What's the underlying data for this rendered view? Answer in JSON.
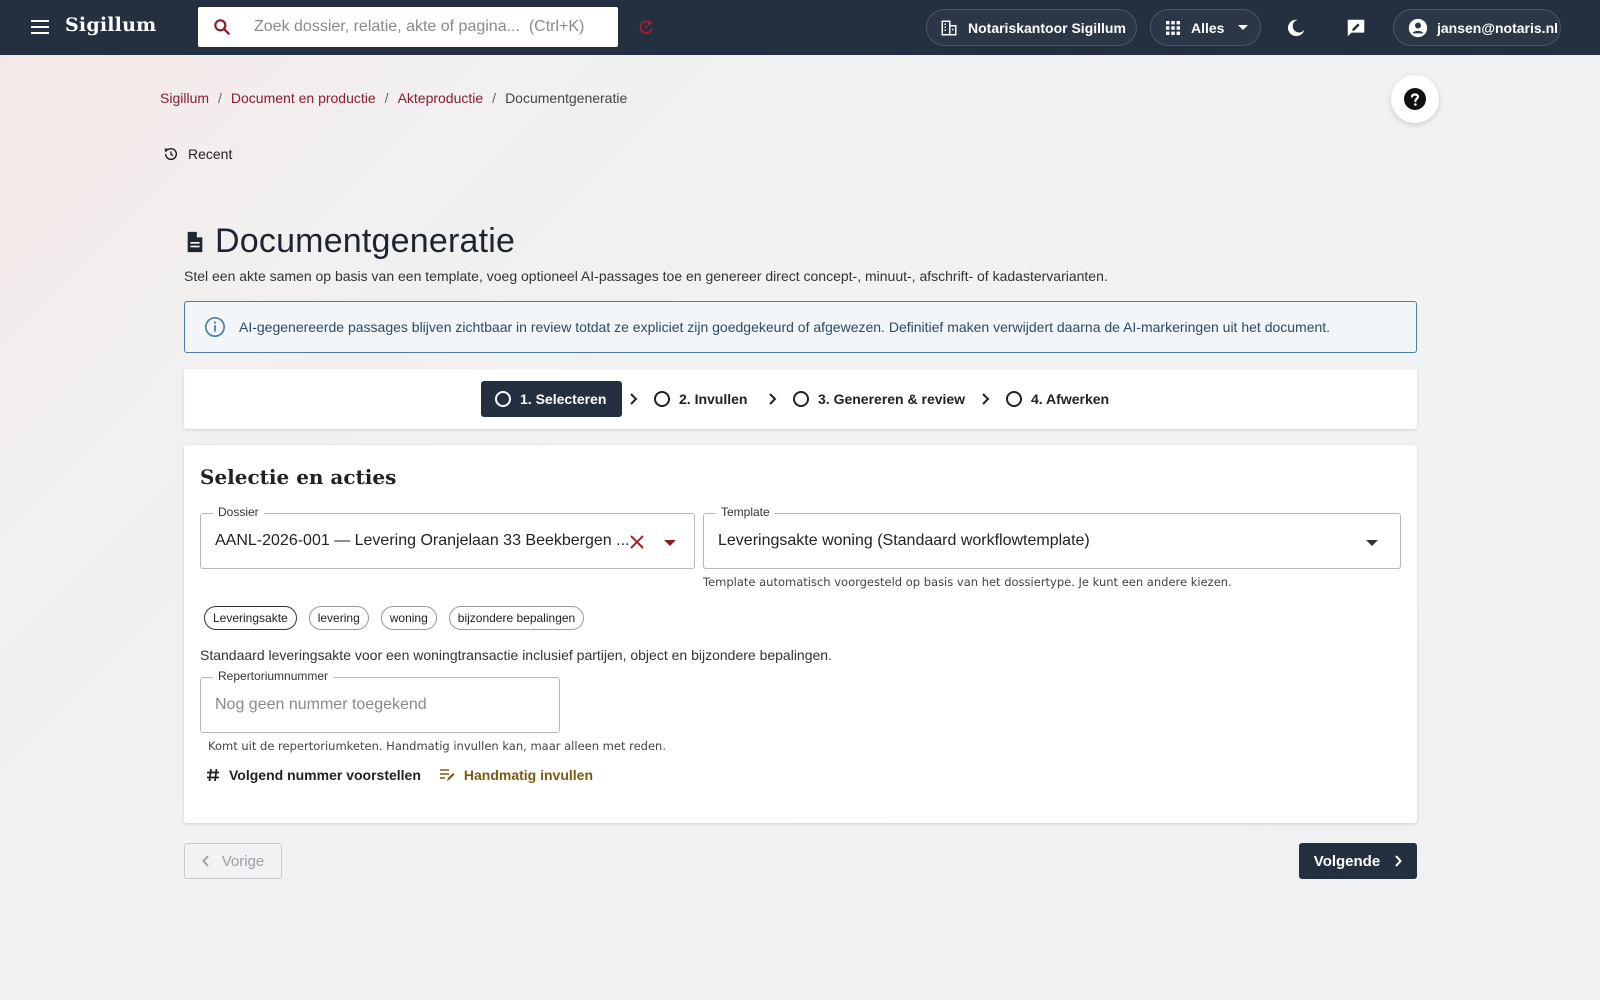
{
  "topbar": {
    "brand": "Sigillum",
    "search_placeholder": "Zoek dossier, relatie, akte of pagina...  (Ctrl+K)",
    "office": "Notariskantoor Sigillum",
    "scope": "Alles",
    "user": "jansen@notaris.nl"
  },
  "breadcrumb": {
    "items": [
      "Sigillum",
      "Document en productie",
      "Akteproductie"
    ],
    "current": "Documentgeneratie"
  },
  "recent_label": "Recent",
  "page": {
    "title": "Documentgeneratie",
    "subtitle": "Stel een akte samen op basis van een template, voeg optioneel AI-passages toe en genereer direct concept-, minuut-, afschrift- of kadastervarianten."
  },
  "info": "AI-gegenereerde passages blijven zichtbaar in review totdat ze expliciet zijn goedgekeurd of afgewezen. Definitief maken verwijdert daarna de AI-markeringen uit het document.",
  "steps": [
    "1. Selecteren",
    "2. Invullen",
    "3. Genereren & review",
    "4. Afwerken"
  ],
  "card": {
    "title": "Selectie en acties",
    "dossier_label": "Dossier",
    "dossier_value": "AANL-2026-001 — Levering Oranjelaan 33 Beekbergen ...",
    "template_label": "Template",
    "template_value": "Leveringsakte woning (Standaard workflowtemplate)",
    "template_helper": "Template automatisch voorgesteld op basis van het dossiertype. Je kunt een andere kiezen.",
    "tags": [
      "Leveringsakte",
      "levering",
      "woning",
      "bijzondere bepalingen"
    ],
    "description": "Standaard leveringsakte voor een woningtransactie inclusief partijen, object en bijzondere bepalingen.",
    "repert_label": "Repertoriumnummer",
    "repert_placeholder": "Nog geen nummer toegekend",
    "repert_helper": "Komt uit de repertoriumketen. Handmatig invullen kan, maar alleen met reden.",
    "action_suggest": "Volgend nummer voorstellen",
    "action_manual": "Handmatig invullen"
  },
  "nav": {
    "prev": "Vorige",
    "next": "Volgende"
  },
  "colors": {
    "topbar": "#243040",
    "accent": "#8a1d2e",
    "info_border": "#4f7ea3",
    "manual_action": "#7a5a10"
  }
}
